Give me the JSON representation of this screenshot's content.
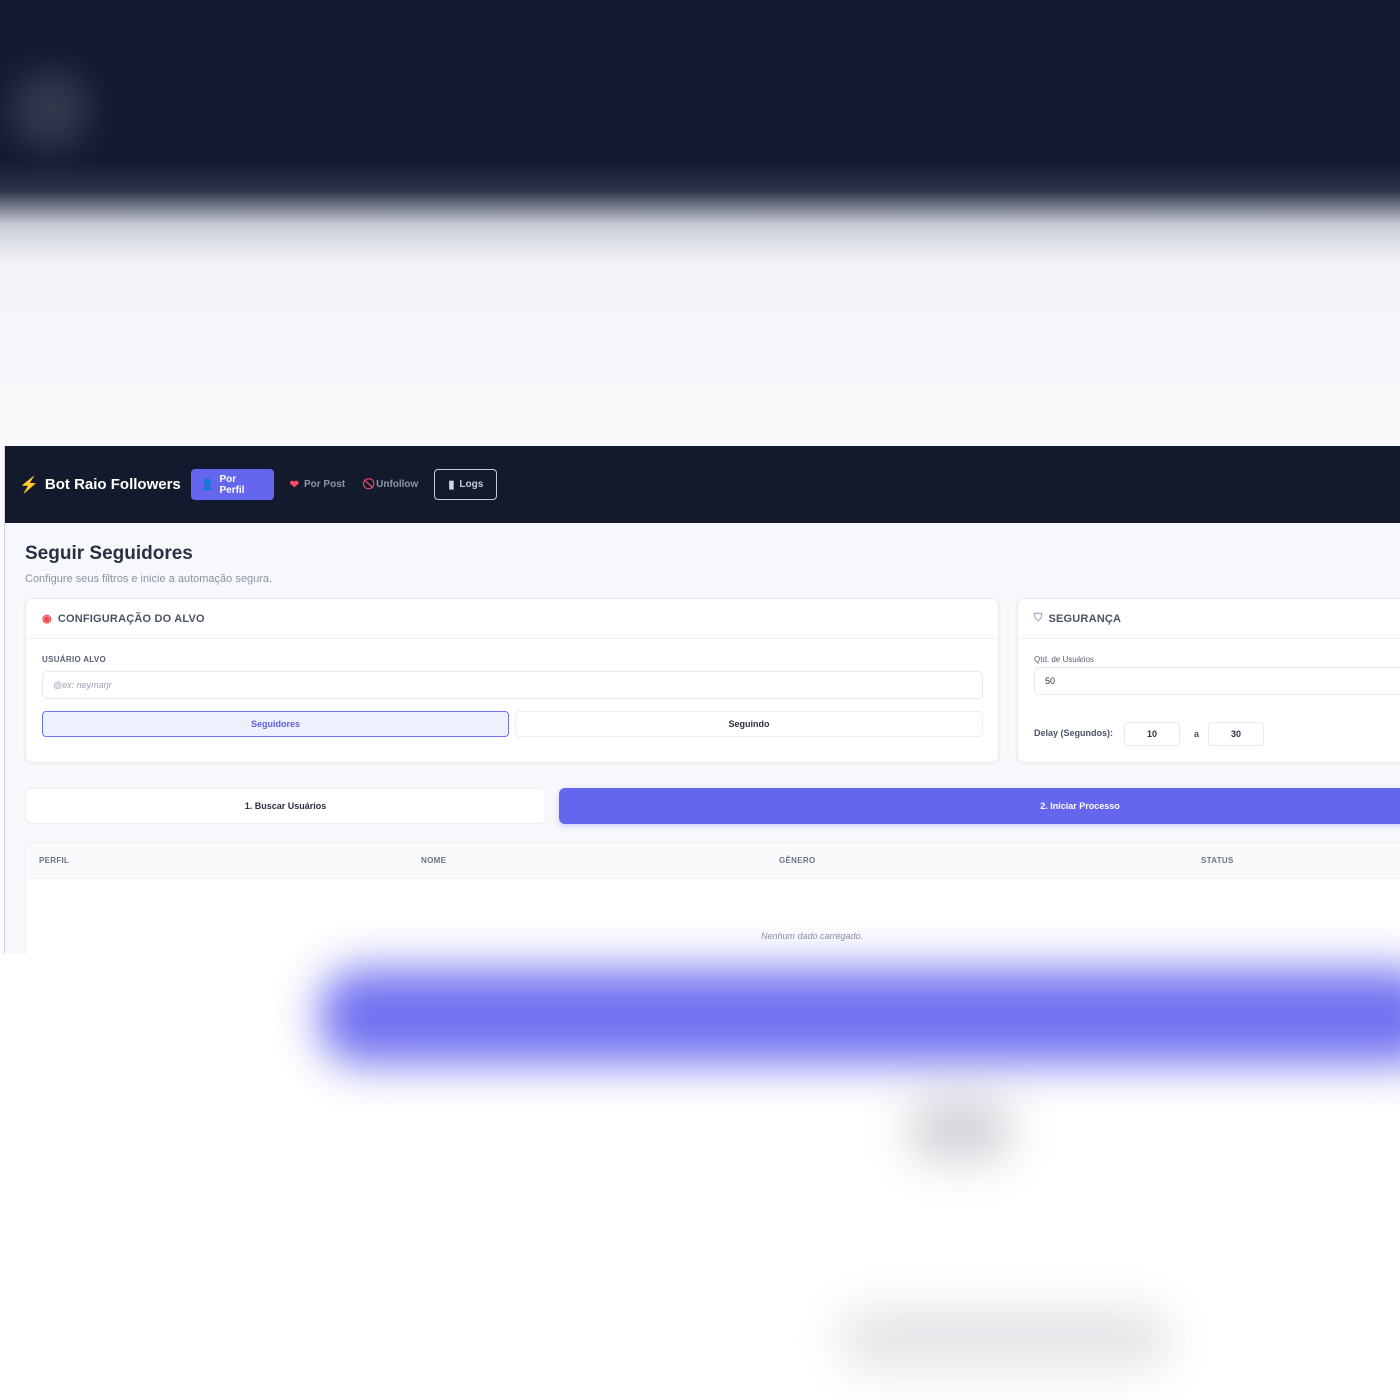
{
  "brand": {
    "icon": "lightning-icon",
    "title": "Bot Raio Followers"
  },
  "nav": [
    {
      "icon": "user-icon",
      "label": "Por Perfil",
      "active": true
    },
    {
      "icon": "heart-icon",
      "label": "Por Post",
      "active": false
    },
    {
      "icon": "ban-icon",
      "label": "Unfollow",
      "active": false
    },
    {
      "icon": "book-icon",
      "label": "Logs",
      "active": false
    }
  ],
  "page": {
    "title": "Seguir Seguidores",
    "subtitle": "Configure seus filtros e inicie a automação segura."
  },
  "target_card": {
    "icon": "target-icon",
    "title": "CONFIGURAÇÃO DO ALVO",
    "user_label": "USUÁRIO ALVO",
    "user_placeholder": "@ex: neymarjr",
    "mode_options": [
      "Seguidores",
      "Seguindo"
    ],
    "mode_selected": "Seguidores"
  },
  "security_card": {
    "icon": "shield-icon",
    "title": "SEGURANÇA",
    "qty_label": "Qtd. de Usuários",
    "qty_value": "50",
    "delay_label": "Delay (Segundos):",
    "delay_min": "10",
    "delay_separator": "a",
    "delay_max": "30"
  },
  "actions": {
    "search_label": "1. Buscar Usuários",
    "start_label": "2. Iniciar Processo"
  },
  "table": {
    "columns": [
      "PERFIL",
      "NOME",
      "GÊNERO",
      "STATUS"
    ],
    "empty_message": "Nenhum dado carregado."
  },
  "colors": {
    "topbar": "#131a2e",
    "accent": "#6566ee",
    "background": "#f7f8fb"
  }
}
